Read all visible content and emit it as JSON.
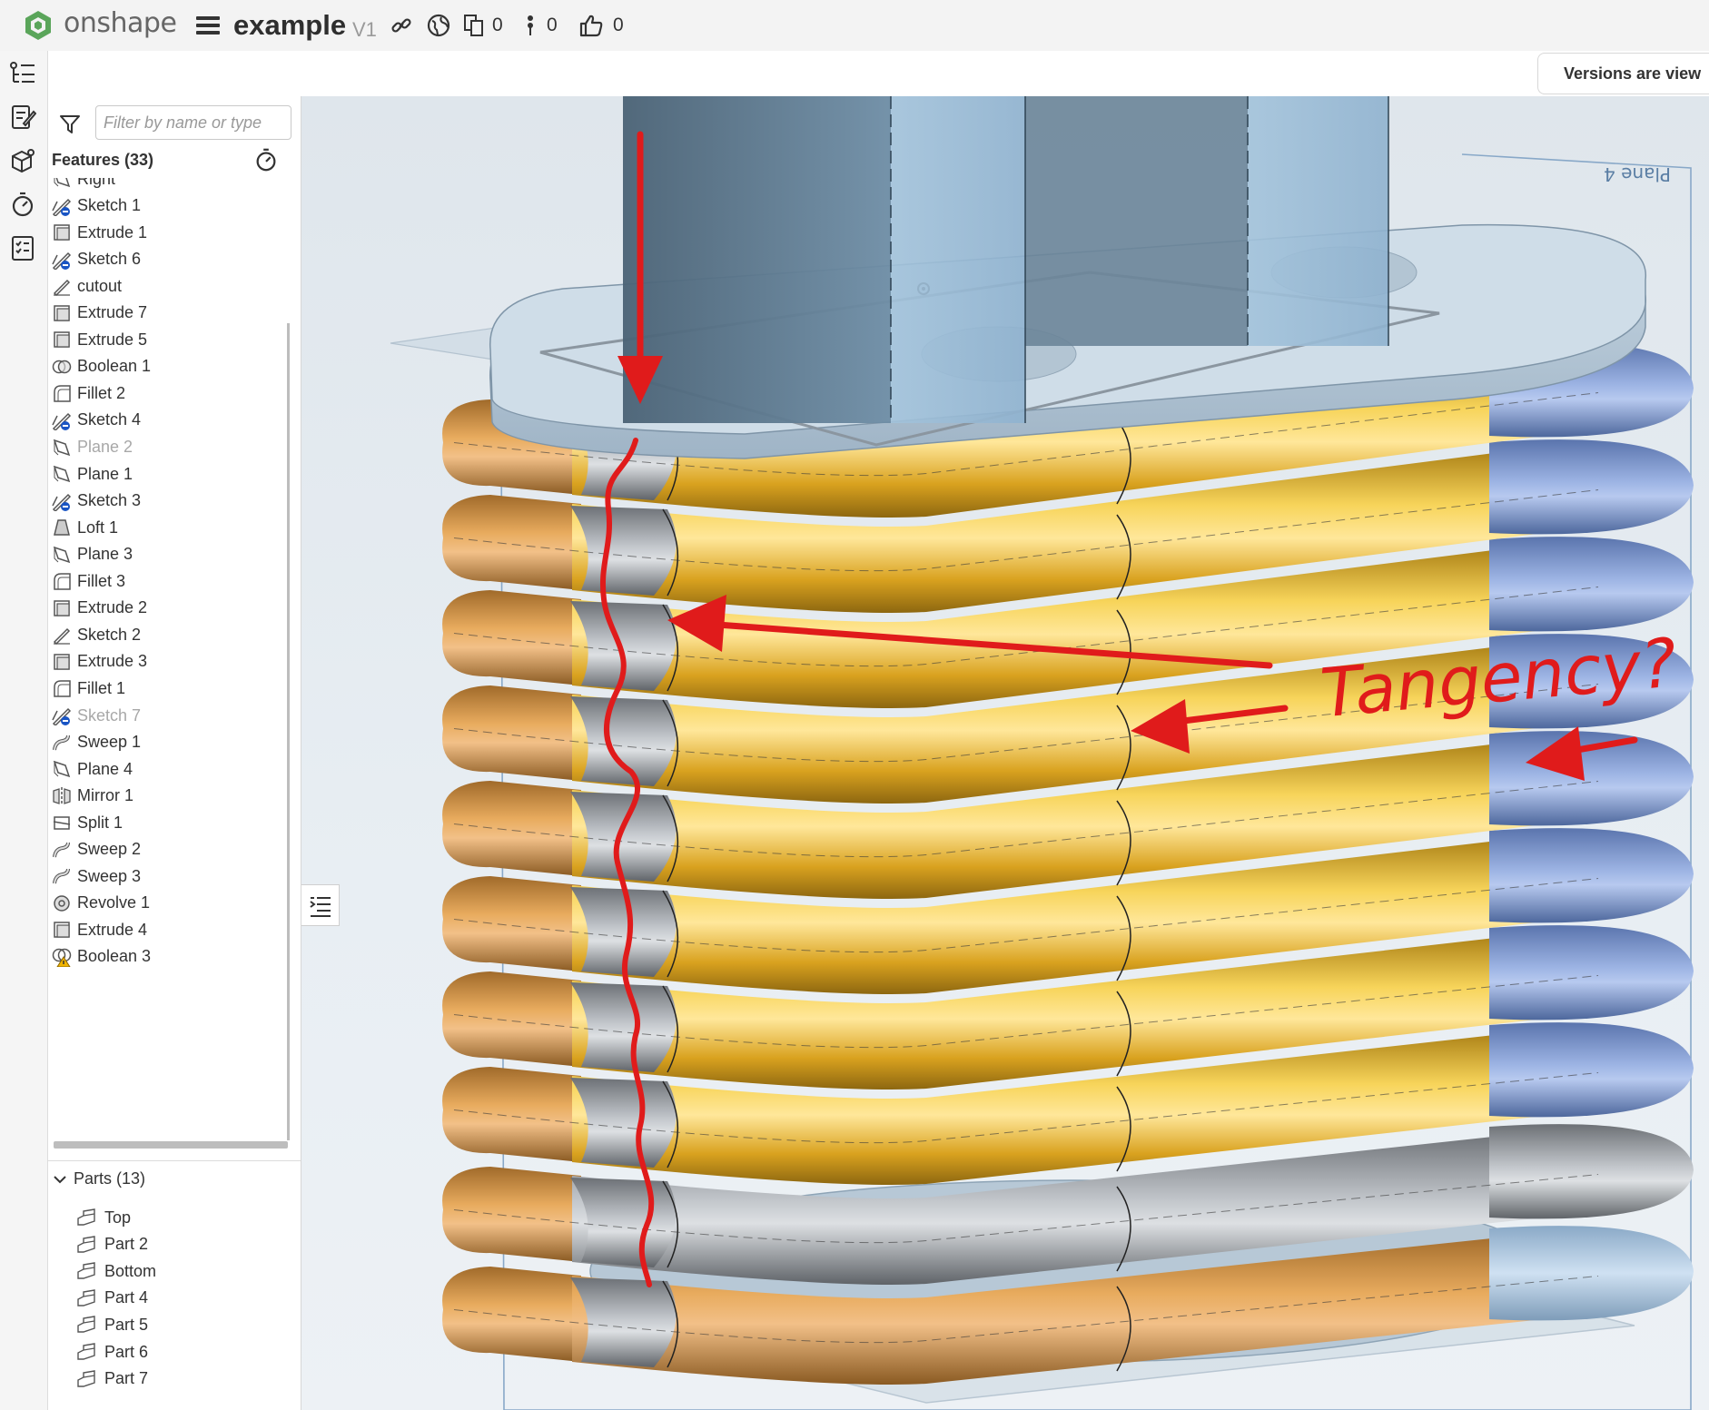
{
  "app": {
    "brand": "onshape",
    "document_title": "example",
    "version_label": "V1",
    "counts": {
      "copies": "0",
      "comments": "0",
      "likes": "0"
    }
  },
  "banner": {
    "versions_note": "Versions are view"
  },
  "feature_panel": {
    "filter_placeholder": "Filter by name or type",
    "features_header": "Features (33)",
    "features": [
      {
        "label": "Right",
        "icon": "plane-icon",
        "dim": false
      },
      {
        "label": "Sketch 1",
        "icon": "sketch-icon",
        "dim": false
      },
      {
        "label": "Extrude 1",
        "icon": "extrude-icon",
        "dim": false
      },
      {
        "label": "Sketch 6",
        "icon": "sketch-icon",
        "dim": false
      },
      {
        "label": "cutout",
        "icon": "pencil-icon",
        "dim": false
      },
      {
        "label": "Extrude 7",
        "icon": "extrude-icon",
        "dim": false
      },
      {
        "label": "Extrude 5",
        "icon": "extrude-icon",
        "dim": false
      },
      {
        "label": "Boolean 1",
        "icon": "boolean-icon",
        "dim": false
      },
      {
        "label": "Fillet 2",
        "icon": "fillet-icon",
        "dim": false
      },
      {
        "label": "Sketch 4",
        "icon": "sketch-icon",
        "dim": false
      },
      {
        "label": "Plane 2",
        "icon": "plane-icon",
        "dim": true
      },
      {
        "label": "Plane 1",
        "icon": "plane-icon",
        "dim": false
      },
      {
        "label": "Sketch 3",
        "icon": "sketch-icon",
        "dim": false
      },
      {
        "label": "Loft 1",
        "icon": "loft-icon",
        "dim": false
      },
      {
        "label": "Plane 3",
        "icon": "plane-icon",
        "dim": false
      },
      {
        "label": "Fillet 3",
        "icon": "fillet-icon",
        "dim": false
      },
      {
        "label": "Extrude 2",
        "icon": "extrude-icon",
        "dim": false
      },
      {
        "label": "Sketch 2",
        "icon": "pencil-icon",
        "dim": false
      },
      {
        "label": "Extrude 3",
        "icon": "extrude-icon",
        "dim": false
      },
      {
        "label": "Fillet 1",
        "icon": "fillet-icon",
        "dim": false
      },
      {
        "label": "Sketch 7",
        "icon": "sketch-icon",
        "dim": true
      },
      {
        "label": "Sweep 1",
        "icon": "sweep-icon",
        "dim": false
      },
      {
        "label": "Plane 4",
        "icon": "plane-icon",
        "dim": false
      },
      {
        "label": "Mirror 1",
        "icon": "mirror-icon",
        "dim": false
      },
      {
        "label": "Split 1",
        "icon": "split-icon",
        "dim": false
      },
      {
        "label": "Sweep 2",
        "icon": "sweep-icon",
        "dim": false
      },
      {
        "label": "Sweep 3",
        "icon": "sweep-icon",
        "dim": false
      },
      {
        "label": "Revolve 1",
        "icon": "revolve-icon",
        "dim": false
      },
      {
        "label": "Extrude 4",
        "icon": "extrude-icon",
        "dim": false
      },
      {
        "label": "Boolean 3",
        "icon": "boolean-warning-icon",
        "dim": false
      }
    ],
    "parts_header": "Parts (13)",
    "parts": [
      "Top",
      "Part 2",
      "Bottom",
      "Part 4",
      "Part 5",
      "Part 6",
      "Part 7"
    ]
  },
  "viewport": {
    "plane_label": "Plane 4",
    "annotation": "Tangency?",
    "colors": {
      "gold": "#e8b52a",
      "orange": "#d99a45",
      "blue": "#7f9bd0",
      "gray": "#9a9ea3",
      "annotation_red": "#e01b1b"
    }
  }
}
